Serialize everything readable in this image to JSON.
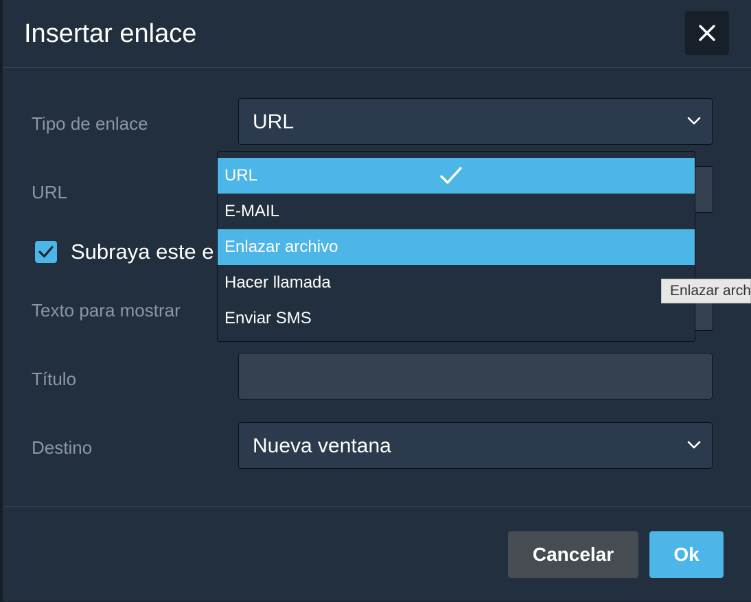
{
  "dialog": {
    "title": "Insertar enlace",
    "close_icon": "close-icon"
  },
  "form": {
    "link_type": {
      "label": "Tipo de enlace",
      "value": "URL",
      "icon": "chevron-down-icon"
    },
    "url": {
      "label": "URL"
    },
    "underline": {
      "label": "Subraya este e",
      "checked": true,
      "icon": "checkmark-icon"
    },
    "display_text": {
      "label": "Texto para mostrar"
    },
    "title_field": {
      "label": "Título",
      "value": ""
    },
    "target": {
      "label": "Destino",
      "value": "Nueva ventana",
      "icon": "chevron-down-icon"
    }
  },
  "dropdown": {
    "options": [
      {
        "label": "URL",
        "selected": true
      },
      {
        "label": "E-MAIL",
        "selected": false
      },
      {
        "label": "Enlazar archivo",
        "selected": false,
        "hovered": true
      },
      {
        "label": "Hacer llamada",
        "selected": false
      },
      {
        "label": "Enviar SMS",
        "selected": false
      }
    ],
    "selected_icon": "check-icon"
  },
  "tooltip": {
    "text": "Enlazar arch"
  },
  "footer": {
    "cancel_label": "Cancelar",
    "ok_label": "Ok"
  },
  "colors": {
    "dialog_bg": "#222f3e",
    "field_bg": "#2b3a4c",
    "accent": "#4db6e8",
    "cancel_bg": "#464c52",
    "label_text": "#8d96a1"
  }
}
